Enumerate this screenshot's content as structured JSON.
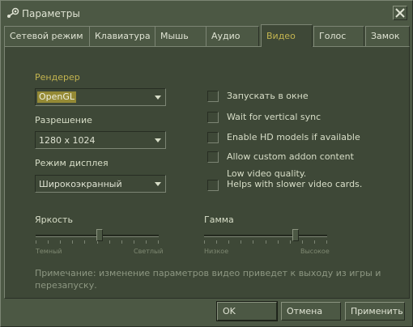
{
  "window": {
    "title": "Параметры"
  },
  "tabs": [
    {
      "label": "Сетевой режим",
      "active": false
    },
    {
      "label": "Клавиатура",
      "active": false
    },
    {
      "label": "Мышь",
      "active": false
    },
    {
      "label": "Аудио",
      "active": false
    },
    {
      "label": "Видео",
      "active": true
    },
    {
      "label": "Голос",
      "active": false
    },
    {
      "label": "Замок",
      "active": false
    }
  ],
  "video": {
    "renderer": {
      "label": "Рендерер",
      "value": "OpenGL"
    },
    "resolution": {
      "label": "Разрешение",
      "value": "1280 x 1024"
    },
    "display_mode": {
      "label": "Режим дисплея",
      "value": "Широкоэкранный"
    },
    "options": [
      {
        "label": "Запускать в окне",
        "checked": false
      },
      {
        "label": "Wait for vertical sync",
        "checked": false
      },
      {
        "label": "Enable HD models if available",
        "checked": false
      },
      {
        "label": "Allow custom addon content",
        "checked": false
      },
      {
        "label": "Low video quality.",
        "label2": "Helps with slower video cards.",
        "checked": false
      }
    ],
    "brightness": {
      "label": "Яркость",
      "min_label": "Темный",
      "max_label": "Светлый",
      "level": 0.52
    },
    "gamma": {
      "label": "Гамма",
      "min_label": "Низкое",
      "max_label": "Высокое",
      "level": 0.76
    },
    "note": "Примечание: изменение параметров видео приведет к выходу из игры и перезапуску."
  },
  "buttons": {
    "ok": "OK",
    "cancel": "Отмена",
    "apply": "Применить"
  },
  "colors": {
    "accent": "#c4b550",
    "background": "#4c5844",
    "panel": "#3e4837"
  },
  "icons": {
    "title": "steam-icon",
    "close": "close-icon",
    "dropdown": "chevron-down-icon"
  }
}
